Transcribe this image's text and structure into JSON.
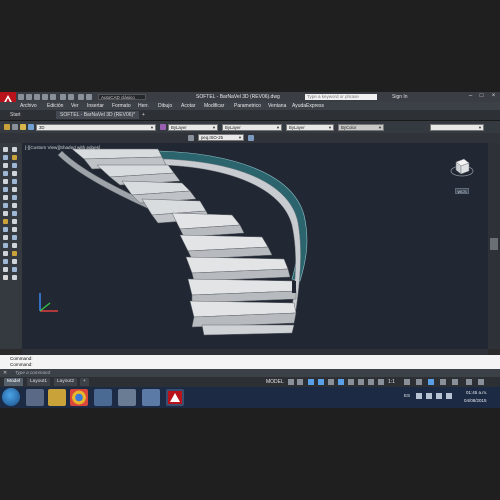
{
  "window": {
    "title": "SOFTEL - BarNaVel 3D (REV06).dwg",
    "workspace": "AutoCAD clásico",
    "search_placeholder": "Type a keyword or phrase",
    "sign_in": "Sign In"
  },
  "menu": [
    "Archivo",
    "Edición",
    "Ver",
    "Insertar",
    "Formato",
    "Herr.",
    "Dibujo",
    "Acotar",
    "Modificar",
    "Parametrico",
    "Ventana",
    "Ayuda",
    "Express"
  ],
  "file_tabs": [
    {
      "label": "Start"
    },
    {
      "label": "SOFTEL - BarNaVel 3D (REV06)*"
    }
  ],
  "toolbar": {
    "layer": "3D",
    "color": "ByLayer",
    "linetype": "ByLayer",
    "lineweight": "ByLayer",
    "plotstyle": "ByColor",
    "dimstyle": "peq.ISO-25"
  },
  "viewport": {
    "label": "[-][Custom View][Shaded with edges]",
    "wcs": "WCS"
  },
  "command": {
    "history": [
      "Command:",
      "Command:"
    ],
    "prompt": "Type a command"
  },
  "layout_tabs": [
    "Model",
    "Layout1",
    "Layout2"
  ],
  "status": {
    "mode": "MODEL",
    "scale": "1:1"
  },
  "taskbar": {
    "language": "ES",
    "time": "01:45 a.m.",
    "date": "04/08/2015"
  },
  "colors": {
    "accent": "#b8131a",
    "viewport_bg": "#222833",
    "glass": "#2e6f78"
  }
}
